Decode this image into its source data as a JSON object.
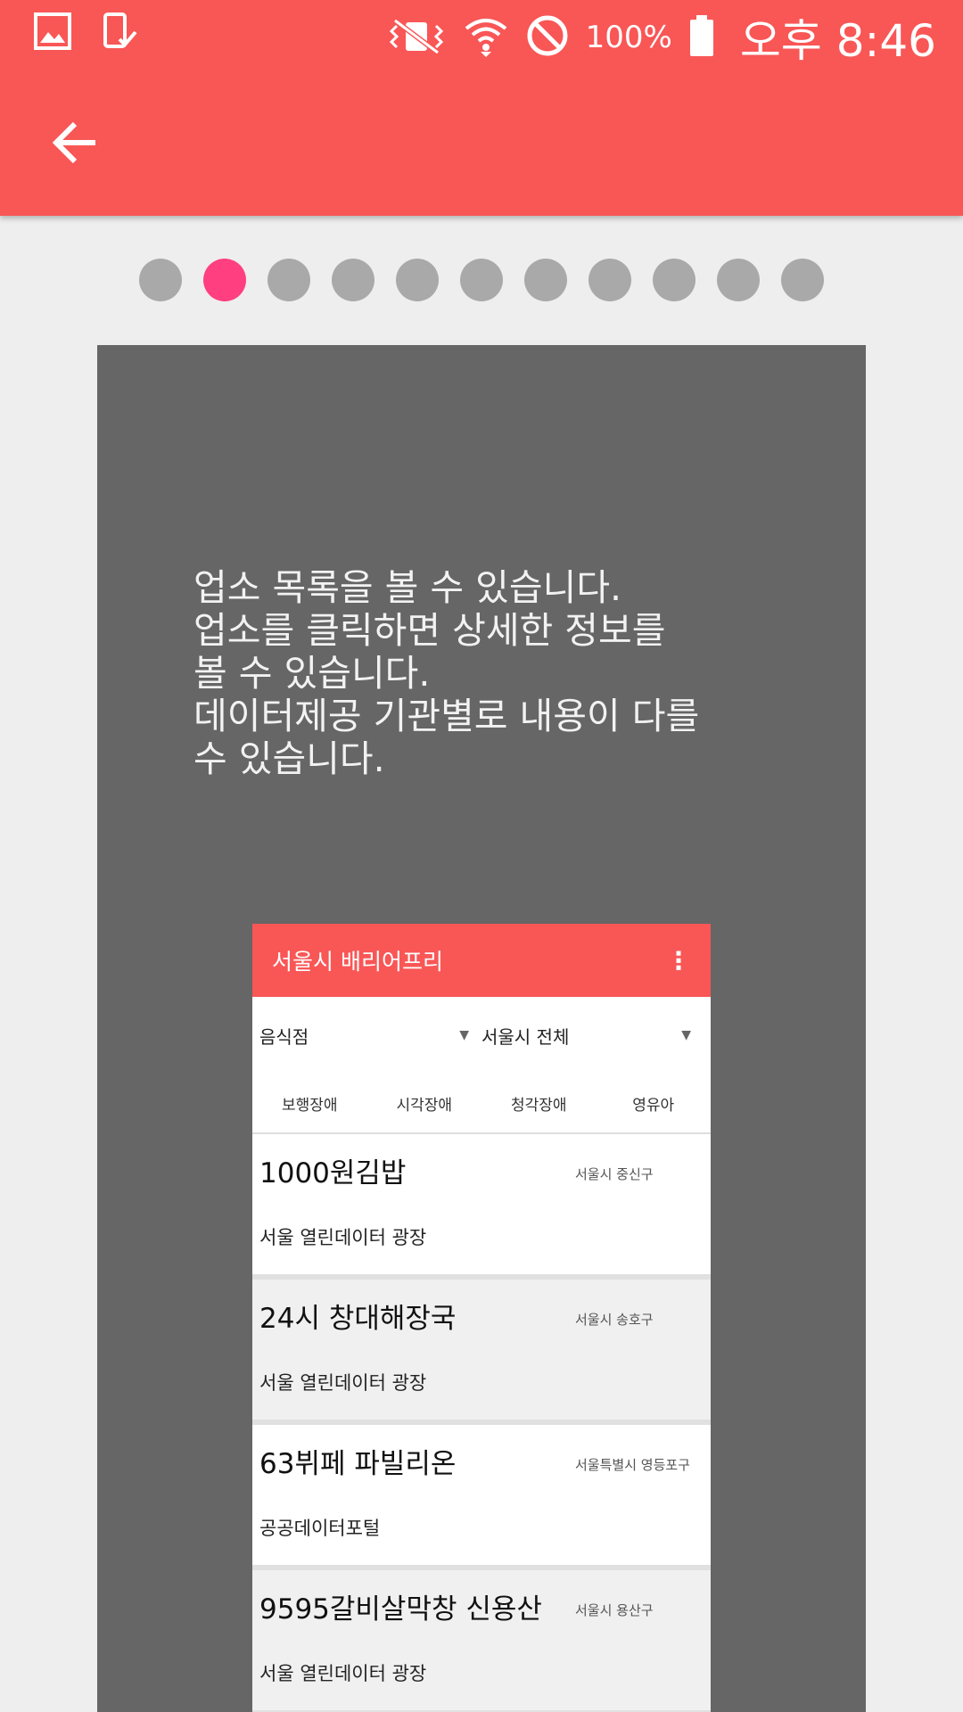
{
  "status_bar": {
    "left_icons": [
      "image-icon",
      "phone-check-icon"
    ],
    "right_icons": [
      "vibrate-mute-icon",
      "wifi-icon",
      "block-icon",
      "battery-icon"
    ],
    "battery": "100%",
    "time": "오후 8:46"
  },
  "app_bar": {
    "back_icon": "arrow-back-icon",
    "color": "#f95656"
  },
  "pager": {
    "total": 11,
    "active_index": 1,
    "active_color": "#ff3f7f",
    "inactive_color": "#a9a9a9"
  },
  "card": {
    "text": "업소 목록을 볼 수 있습니다.\n업소를 클릭하면 상세한 정보를\n볼 수 있습니다.\n데이터제공 기관별로 내용이 다를\n수 있습니다."
  },
  "mockup": {
    "title": "서울시 배리어프리",
    "menu_icon": "more-vert-icon",
    "filter_category": "음식점",
    "filter_region": "서울시 전체",
    "tabs": [
      "보행장애",
      "시각장애",
      "청각장애",
      "영유아"
    ],
    "items": [
      {
        "name": "1000원김밥",
        "area": "서울시 중신구",
        "source": "서울 열린데이터 광장"
      },
      {
        "name": "24시 창대해장국",
        "area": "서울시 송호구",
        "source": "서울 열린데이터 광장"
      },
      {
        "name": "63뷔페 파빌리온",
        "area": "서울특별시 영등포구",
        "source": "공공데이터포털"
      },
      {
        "name": "9595갈비살막창 신용산",
        "area": "서울시 용산구",
        "source": "서울 열린데이터 광장"
      }
    ]
  }
}
